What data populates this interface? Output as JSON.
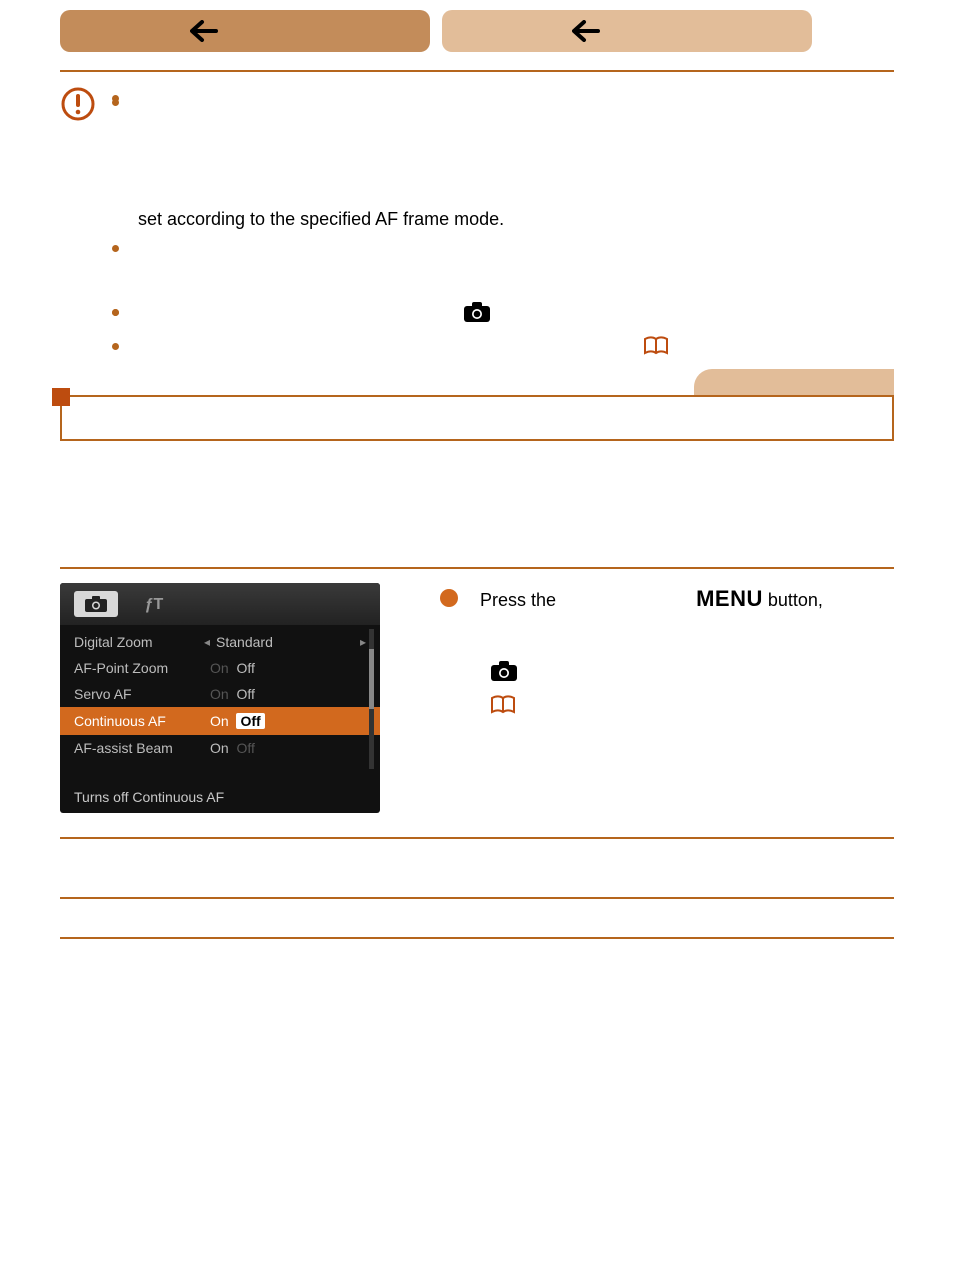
{
  "bullets": {
    "b1": "",
    "b2_line2": "set according to the specified AF frame mode.",
    "b3": "",
    "b4": "",
    "b5_pre": "",
    "b6_pre": ""
  },
  "menu_shot": {
    "tools_icon_label": "⚒",
    "rows": {
      "r1_l": "Digital Zoom",
      "r1_val": "Standard",
      "r2_l": "AF-Point Zoom",
      "r2_on": "On",
      "r2_off": "Off",
      "r3_l": "Servo AF",
      "r3_on": "On",
      "r3_off": "Off",
      "r4_l": "Continuous AF",
      "r4_on": "On",
      "r4_off": "Off",
      "r5_l": "AF-assist Beam",
      "r5_on": "On",
      "r5_off": "Off"
    },
    "help": "Turns off Continuous AF"
  },
  "instructions": {
    "step1_a": "Press the ",
    "step1_b": " button,"
  },
  "table": {
    "r1_k": "",
    "r1_v": "",
    "r2_k": "",
    "r2_v": ""
  }
}
